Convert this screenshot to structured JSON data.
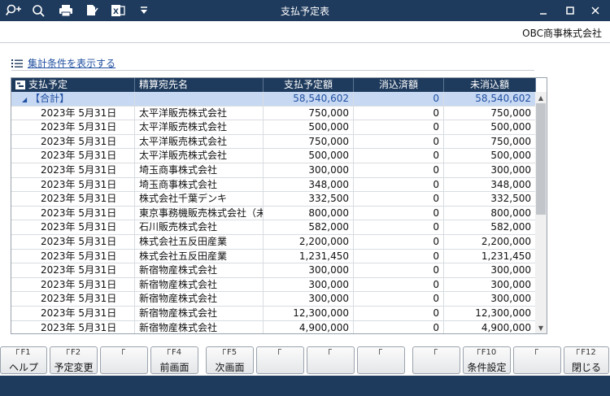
{
  "window": {
    "title": "支払予定表"
  },
  "company": "OBC商事株式会社",
  "filter_link": "集計条件を表示する",
  "grid": {
    "columns": [
      "支払予定",
      "精算宛先名",
      "支払予定額",
      "消込済額",
      "未消込額"
    ],
    "total": {
      "label": "【合計】",
      "planned": "58,540,602",
      "cleared": "0",
      "uncleared": "58,540,602"
    },
    "rows": [
      {
        "date": "2023年  5月31日",
        "payee": "太平洋販売株式会社",
        "planned": "750,000",
        "cleared": "0",
        "uncleared": "750,000"
      },
      {
        "date": "2023年  5月31日",
        "payee": "太平洋販売株式会社",
        "planned": "500,000",
        "cleared": "0",
        "uncleared": "500,000"
      },
      {
        "date": "2023年  5月31日",
        "payee": "太平洋販売株式会社",
        "planned": "750,000",
        "cleared": "0",
        "uncleared": "750,000"
      },
      {
        "date": "2023年  5月31日",
        "payee": "太平洋販売株式会社",
        "planned": "500,000",
        "cleared": "0",
        "uncleared": "500,000"
      },
      {
        "date": "2023年  5月31日",
        "payee": "埼玉商事株式会社",
        "planned": "300,000",
        "cleared": "0",
        "uncleared": "300,000"
      },
      {
        "date": "2023年  5月31日",
        "payee": "埼玉商事株式会社",
        "planned": "348,000",
        "cleared": "0",
        "uncleared": "348,000"
      },
      {
        "date": "2023年  5月31日",
        "payee": "株式会社千葉デンキ",
        "planned": "332,500",
        "cleared": "0",
        "uncleared": "332,500"
      },
      {
        "date": "2023年  5月31日",
        "payee": "東京事務機販売株式会社（未",
        "planned": "800,000",
        "cleared": "0",
        "uncleared": "800,000"
      },
      {
        "date": "2023年  5月31日",
        "payee": "石川販売株式会社",
        "planned": "582,000",
        "cleared": "0",
        "uncleared": "582,000"
      },
      {
        "date": "2023年  5月31日",
        "payee": "株式会社五反田産業",
        "planned": "2,200,000",
        "cleared": "0",
        "uncleared": "2,200,000"
      },
      {
        "date": "2023年  5月31日",
        "payee": "株式会社五反田産業",
        "planned": "1,231,450",
        "cleared": "0",
        "uncleared": "1,231,450"
      },
      {
        "date": "2023年  5月31日",
        "payee": "新宿物産株式会社",
        "planned": "300,000",
        "cleared": "0",
        "uncleared": "300,000"
      },
      {
        "date": "2023年  5月31日",
        "payee": "新宿物産株式会社",
        "planned": "300,000",
        "cleared": "0",
        "uncleared": "300,000"
      },
      {
        "date": "2023年  5月31日",
        "payee": "新宿物産株式会社",
        "planned": "300,000",
        "cleared": "0",
        "uncleared": "300,000"
      },
      {
        "date": "2023年  5月31日",
        "payee": "新宿物産株式会社",
        "planned": "12,300,000",
        "cleared": "0",
        "uncleared": "12,300,000"
      },
      {
        "date": "2023年  5月31日",
        "payee": "新宿物産株式会社",
        "planned": "4,900,000",
        "cleared": "0",
        "uncleared": "4,900,000"
      }
    ]
  },
  "fkeys": [
    {
      "key": "F1",
      "label": "ヘルプ"
    },
    {
      "key": "F2",
      "label": "予定変更"
    },
    {
      "key": "",
      "label": ""
    },
    {
      "key": "F4",
      "label": "前画面"
    },
    {
      "key": "F5",
      "label": "次画面"
    },
    {
      "key": "",
      "label": ""
    },
    {
      "key": "",
      "label": ""
    },
    {
      "key": "",
      "label": ""
    },
    {
      "key": "",
      "label": ""
    },
    {
      "key": "F10",
      "label": "条件設定"
    },
    {
      "key": "",
      "label": ""
    },
    {
      "key": "F12",
      "label": "閉じる"
    }
  ],
  "colors": {
    "navy": "#1e3a5c",
    "total_row": "#c7d8f3",
    "link": "#1f4fa0"
  }
}
